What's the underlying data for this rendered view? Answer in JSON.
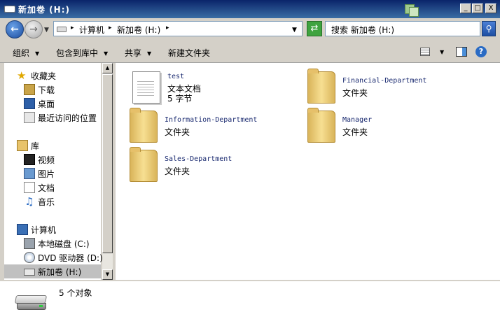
{
  "window": {
    "title": "新加卷 (H:)",
    "buttons": {
      "minimize": "_",
      "maximize": "□",
      "close": "X"
    }
  },
  "address": {
    "crumbs": [
      "计算机",
      "新加卷 (H:)"
    ],
    "search_placeholder": "搜索 新加卷 (H:)"
  },
  "toolbar": {
    "organize": "组织",
    "include_in_library": "包含到库中",
    "share": "共享",
    "new_folder": "新建文件夹"
  },
  "navigation": {
    "favorites_label": "收藏夹",
    "favorites": [
      "下载",
      "桌面",
      "最近访问的位置"
    ],
    "libraries_label": "库",
    "libraries": [
      "视频",
      "图片",
      "文档",
      "音乐"
    ],
    "computer_label": "计算机",
    "drives": [
      "本地磁盘 (C:)",
      "DVD 驱动器 (D:)",
      "新加卷 (H:)"
    ]
  },
  "files": [
    {
      "name": "test",
      "type": "文本文档",
      "size": "5 字节",
      "icon": "text-file-icon"
    },
    {
      "name": "Financial-Department",
      "type": "文件夹",
      "icon": "folder-icon"
    },
    {
      "name": "Information-Department",
      "type": "文件夹",
      "icon": "folder-icon"
    },
    {
      "name": "Manager",
      "type": "文件夹",
      "icon": "folder-icon"
    },
    {
      "name": "Sales-Department",
      "type": "文件夹",
      "icon": "folder-icon"
    }
  ],
  "status": {
    "count": "5 个对象"
  }
}
